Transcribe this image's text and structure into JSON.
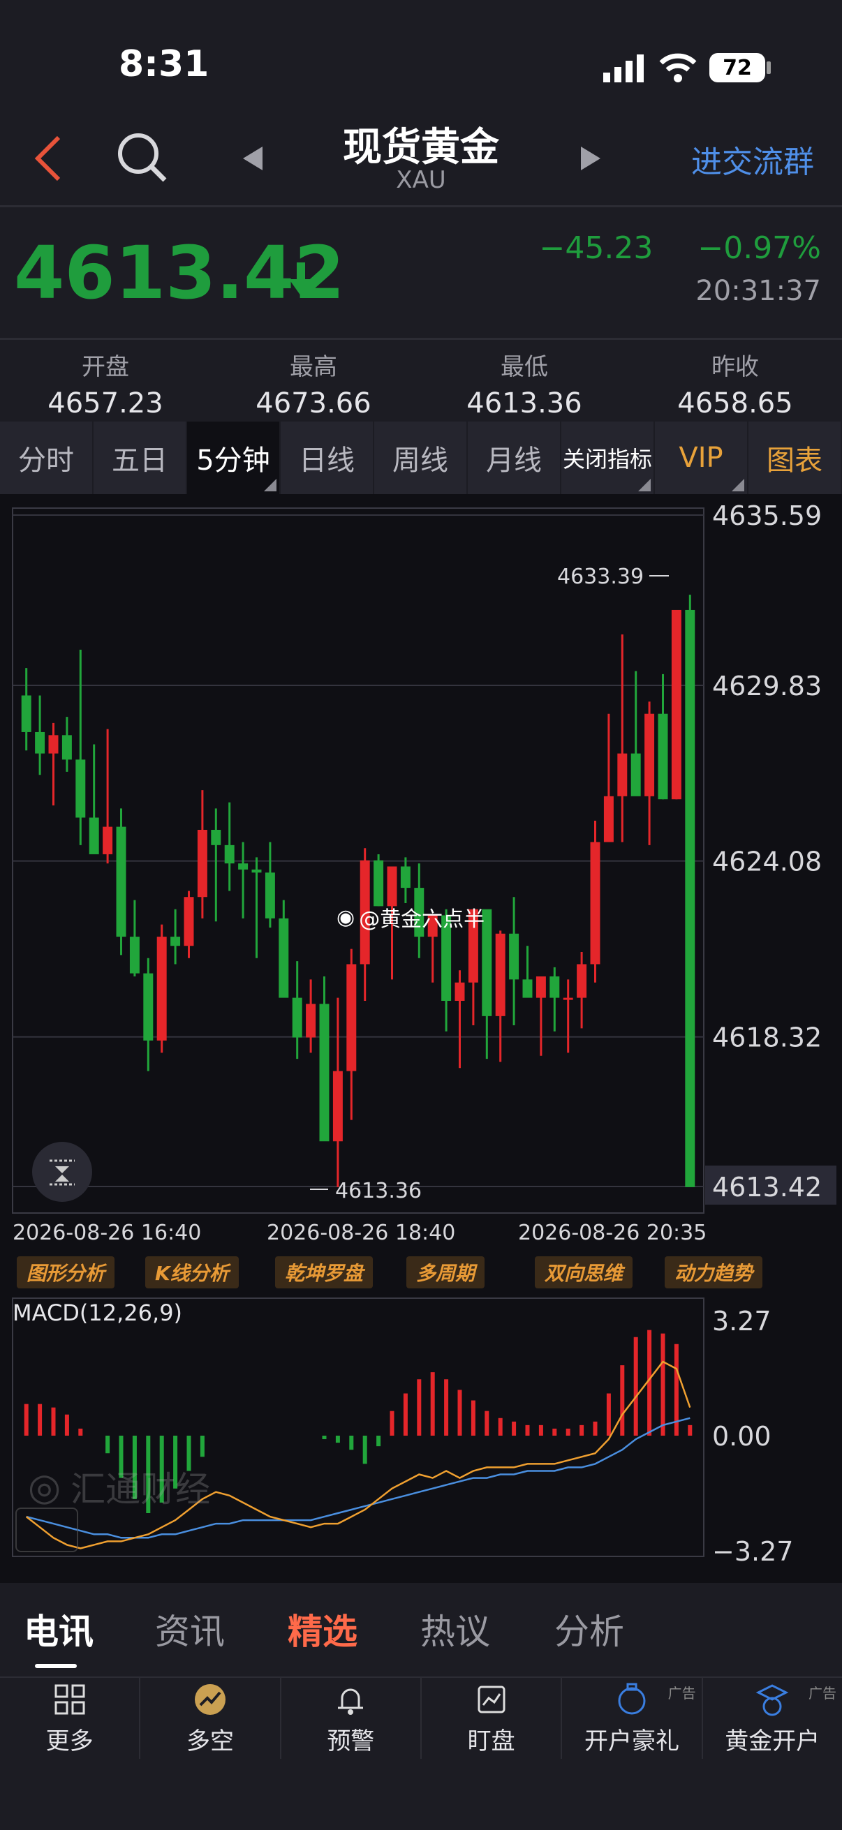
{
  "status_bar": {
    "time": "8:31",
    "battery": "72",
    "icons": [
      "signal-icon",
      "wifi-icon",
      "battery-icon"
    ]
  },
  "header": {
    "title": "现货黄金",
    "subtitle": "XAU",
    "group_button": "进交流群",
    "icons": [
      "back-icon",
      "search-icon",
      "prev-arrow-icon",
      "next-arrow-icon"
    ]
  },
  "quote": {
    "price": "4613.42",
    "direction": "down",
    "change": "−45.23",
    "change_pct": "−0.97%",
    "time": "20:31:37"
  },
  "ohlc": [
    {
      "label": "开盘",
      "value": "4657.23"
    },
    {
      "label": "最高",
      "value": "4673.66"
    },
    {
      "label": "最低",
      "value": "4613.36"
    },
    {
      "label": "昨收",
      "value": "4658.65"
    }
  ],
  "tabs": [
    {
      "label": "分时"
    },
    {
      "label": "五日"
    },
    {
      "label": "5分钟"
    },
    {
      "label": "日线"
    },
    {
      "label": "周线"
    },
    {
      "label": "月线"
    },
    {
      "label": "关闭指标"
    },
    {
      "label": "VIP"
    },
    {
      "label": "图表"
    }
  ],
  "active_tab": "5分钟",
  "watermark": "@黄金六点半",
  "chart_data": [
    {
      "type": "candlestick",
      "y_ticks": [
        "4635.59",
        "4629.83",
        "4624.08",
        "4618.32",
        "4613.42"
      ],
      "ylim": [
        4613.42,
        4635.59
      ],
      "x_ticks": [
        "2026-08-26 16:40",
        "2026-08-26 18:40",
        "2026-08-26 20:35"
      ],
      "high_annotation": "4633.39",
      "low_annotation": "4613.36",
      "current_price_label": "4613.42",
      "up_color": "#e5262a",
      "down_color": "#21a63b",
      "candles": [
        [
          4629.5,
          4630.4,
          4627.7,
          4628.3
        ],
        [
          4628.3,
          4629.5,
          4626.9,
          4627.6
        ],
        [
          4627.6,
          4628.6,
          4625.9,
          4628.2
        ],
        [
          4628.2,
          4628.8,
          4627.0,
          4627.4
        ],
        [
          4627.4,
          4631.0,
          4624.6,
          4625.5
        ],
        [
          4625.5,
          4627.9,
          4624.7,
          4624.3
        ],
        [
          4624.3,
          4628.4,
          4624.0,
          4625.2
        ],
        [
          4625.2,
          4625.8,
          4621.0,
          4621.6
        ],
        [
          4621.6,
          4622.8,
          4620.3,
          4620.4
        ],
        [
          4620.4,
          4620.9,
          4617.2,
          4618.2
        ],
        [
          4618.2,
          4622.0,
          4617.8,
          4621.6
        ],
        [
          4621.6,
          4622.5,
          4620.7,
          4621.3
        ],
        [
          4621.3,
          4623.1,
          4620.9,
          4622.9
        ],
        [
          4622.9,
          4626.4,
          4622.2,
          4625.1
        ],
        [
          4625.1,
          4625.8,
          4622.1,
          4624.6
        ],
        [
          4624.6,
          4626.0,
          4623.1,
          4624.0
        ],
        [
          4624.0,
          4624.7,
          4622.2,
          4623.8
        ],
        [
          4623.8,
          4624.2,
          4620.9,
          4623.7
        ],
        [
          4623.7,
          4624.7,
          4621.9,
          4622.2
        ],
        [
          4622.2,
          4622.8,
          4619.8,
          4619.6
        ],
        [
          4619.6,
          4620.8,
          4617.6,
          4618.3
        ],
        [
          4618.3,
          4620.2,
          4617.8,
          4619.4
        ],
        [
          4619.4,
          4620.3,
          4617.9,
          4614.9
        ],
        [
          4614.9,
          4619.6,
          4613.4,
          4617.2
        ],
        [
          4617.2,
          4621.2,
          4615.6,
          4620.7
        ],
        [
          4620.7,
          4624.5,
          4619.5,
          4624.1
        ],
        [
          4624.1,
          4624.3,
          4622.6,
          4622.6
        ],
        [
          4622.6,
          4623.9,
          4620.2,
          4623.9
        ],
        [
          4623.9,
          4624.2,
          4622.7,
          4623.2
        ],
        [
          4623.2,
          4624.0,
          4620.9,
          4621.6
        ],
        [
          4621.6,
          4622.3,
          4620.1,
          4622.3
        ],
        [
          4622.3,
          4622.5,
          4618.5,
          4619.5
        ],
        [
          4619.5,
          4620.5,
          4617.3,
          4620.1
        ],
        [
          4620.1,
          4622.1,
          4618.7,
          4622.5
        ],
        [
          4622.5,
          4622.2,
          4617.6,
          4619.0
        ],
        [
          4619.0,
          4621.8,
          4617.5,
          4621.7
        ],
        [
          4621.7,
          4622.9,
          4618.7,
          4620.2
        ],
        [
          4620.2,
          4621.3,
          4620.0,
          4619.6
        ],
        [
          4619.6,
          4620.2,
          4617.7,
          4620.3
        ],
        [
          4620.3,
          4620.6,
          4618.5,
          4619.6
        ],
        [
          4619.6,
          4620.2,
          4617.8,
          4619.6
        ],
        [
          4619.6,
          4621.1,
          4618.6,
          4620.7
        ],
        [
          4620.7,
          4625.4,
          4620.1,
          4624.7
        ],
        [
          4624.7,
          4628.9,
          4624.7,
          4626.2
        ],
        [
          4626.2,
          4631.5,
          4624.7,
          4627.6
        ],
        [
          4627.6,
          4630.3,
          4626.5,
          4626.2
        ],
        [
          4626.2,
          4629.3,
          4624.6,
          4628.9
        ],
        [
          4628.9,
          4630.2,
          4626.1,
          4626.1
        ],
        [
          4626.1,
          4630.9,
          4626.1,
          4632.3
        ],
        [
          4632.3,
          4632.8,
          4626.6,
          4613.4
        ]
      ]
    },
    {
      "type": "macd",
      "title": "MACD(12,26,9)",
      "y_ticks": [
        "3.27",
        "0.00",
        "−3.27"
      ],
      "ylim": [
        -3.27,
        3.27
      ],
      "histogram": [
        0.9,
        0.9,
        0.8,
        0.6,
        0.2,
        0,
        -0.5,
        -1.2,
        -1.8,
        -2.2,
        -1.9,
        -1.5,
        -1,
        -0.6,
        0,
        0,
        0,
        0,
        0,
        0,
        0,
        0,
        -0.1,
        -0.2,
        -0.4,
        -0.8,
        -0.3,
        0.7,
        1.2,
        1.6,
        1.8,
        1.6,
        1.3,
        1,
        0.7,
        0.5,
        0.4,
        0.3,
        0.3,
        0.2,
        0.2,
        0.3,
        0.4,
        1.2,
        2,
        2.8,
        3,
        2.9,
        2.6,
        0.3
      ],
      "dif": [
        -2.3,
        -2.6,
        -2.9,
        -3.1,
        -3.2,
        -3.1,
        -3,
        -3,
        -2.9,
        -2.8,
        -2.6,
        -2.4,
        -2.1,
        -1.8,
        -1.6,
        -1.7,
        -1.9,
        -2.1,
        -2.3,
        -2.4,
        -2.5,
        -2.6,
        -2.5,
        -2.5,
        -2.3,
        -2.1,
        -1.8,
        -1.5,
        -1.3,
        -1.1,
        -1.2,
        -1,
        -1.2,
        -1,
        -0.9,
        -0.9,
        -0.9,
        -0.8,
        -0.8,
        -0.8,
        -0.7,
        -0.6,
        -0.5,
        -0.1,
        0.6,
        1.1,
        1.6,
        2.1,
        1.9,
        0.8
      ],
      "dea": [
        -2.3,
        -2.4,
        -2.5,
        -2.6,
        -2.7,
        -2.8,
        -2.8,
        -2.9,
        -2.9,
        -2.9,
        -2.8,
        -2.8,
        -2.7,
        -2.6,
        -2.5,
        -2.5,
        -2.4,
        -2.4,
        -2.4,
        -2.4,
        -2.4,
        -2.4,
        -2.3,
        -2.2,
        -2.1,
        -2,
        -1.9,
        -1.8,
        -1.7,
        -1.6,
        -1.5,
        -1.4,
        -1.3,
        -1.2,
        -1.2,
        -1.1,
        -1.1,
        -1,
        -1,
        -1,
        -0.9,
        -0.9,
        -0.8,
        -0.6,
        -0.4,
        -0.1,
        0.1,
        0.3,
        0.4,
        0.5
      ],
      "dif_color": "#f0a030",
      "dea_color": "#4a8fe0"
    }
  ],
  "feature_buttons": [
    "图形分析",
    "K线分析",
    "乾坤罗盘",
    "多周期",
    "双向思维",
    "动力趋势"
  ],
  "nav_tabs": [
    {
      "label": "电讯",
      "state": "active"
    },
    {
      "label": "资讯",
      "state": ""
    },
    {
      "label": "精选",
      "state": "hot"
    },
    {
      "label": "热议",
      "state": ""
    },
    {
      "label": "分析",
      "state": ""
    }
  ],
  "bottom_bar": [
    {
      "label": "更多",
      "icon": "grid-icon"
    },
    {
      "label": "多空",
      "icon": "trend-icon"
    },
    {
      "label": "预警",
      "icon": "bell-icon"
    },
    {
      "label": "盯盘",
      "icon": "monitor-icon"
    },
    {
      "label": "开户豪礼",
      "icon": "gift-icon",
      "ad": "广告"
    },
    {
      "label": "黄金开户",
      "icon": "account-icon",
      "ad": "广告"
    }
  ],
  "brand_watermark": "汇通财经"
}
